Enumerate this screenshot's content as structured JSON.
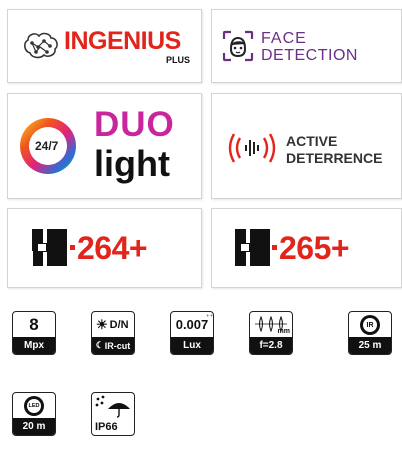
{
  "tiles": {
    "ingenius": {
      "brand": "INGENIUS",
      "sub": "PLUS"
    },
    "face": {
      "line1": "FACE",
      "line2": "DETECTION"
    },
    "duo": {
      "badge": "24/7",
      "word1": "DUO",
      "word2": "light"
    },
    "deterrence": {
      "line1": "ACTIVE",
      "line2": "DETERRENCE"
    },
    "h264": {
      "letter": "H",
      "text": "264+"
    },
    "h265": {
      "letter": "H",
      "text": "265+"
    }
  },
  "badges": {
    "mpx": {
      "top": "8",
      "bottom": "Mpx"
    },
    "dn": {
      "top": "D/N",
      "bottom": "IR-cut"
    },
    "lux": {
      "top": "0.007",
      "bottom": "Lux"
    },
    "focal": {
      "unit": "mm",
      "bottom": "f=2.8"
    },
    "ir": {
      "icon_text": "IR",
      "bottom": "25 m"
    },
    "led": {
      "icon_text": "LED",
      "bottom": "20 m"
    },
    "ip": {
      "bottom": "IP66"
    }
  },
  "colors": {
    "red": "#e1251b",
    "purple": "#6b2f86",
    "ink": "#111111",
    "grey": "#555555"
  }
}
